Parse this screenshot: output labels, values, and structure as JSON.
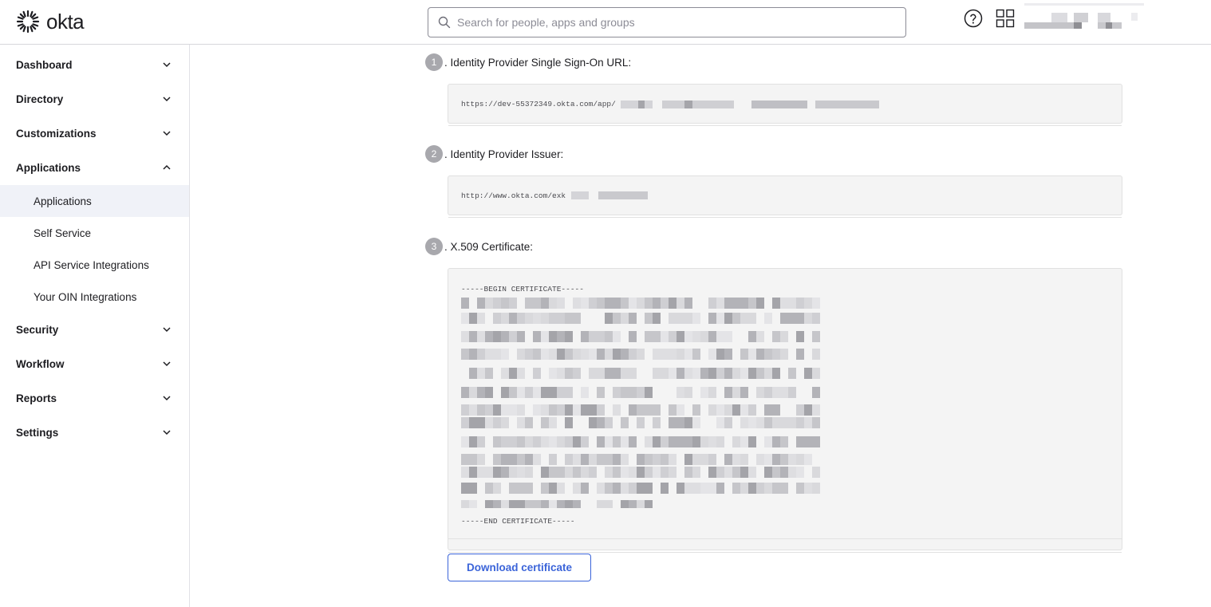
{
  "header": {
    "logo_text": "okta",
    "search": {
      "placeholder": "Search for people, apps and groups",
      "value": ""
    }
  },
  "sidebar": {
    "items": [
      {
        "label": "Dashboard",
        "expanded": false
      },
      {
        "label": "Directory",
        "expanded": false
      },
      {
        "label": "Customizations",
        "expanded": false
      },
      {
        "label": "Applications",
        "expanded": true,
        "children": [
          {
            "label": "Applications",
            "active": true
          },
          {
            "label": "Self Service",
            "active": false
          },
          {
            "label": "API Service Integrations",
            "active": false
          },
          {
            "label": "Your OIN Integrations",
            "active": false
          }
        ]
      },
      {
        "label": "Security",
        "expanded": false
      },
      {
        "label": "Workflow",
        "expanded": false
      },
      {
        "label": "Reports",
        "expanded": false
      },
      {
        "label": "Settings",
        "expanded": false
      }
    ]
  },
  "main": {
    "steps": [
      {
        "number": "1",
        "label": ". Identity Provider Single Sign-On URL:",
        "value": "https://dev-55372349.okta.com/app/"
      },
      {
        "number": "2",
        "label": ". Identity Provider Issuer:",
        "value": "http://www.okta.com/exk"
      },
      {
        "number": "3",
        "label": ". X.509 Certificate:",
        "begin": "-----BEGIN CERTIFICATE-----",
        "end": "-----END CERTIFICATE-----"
      }
    ],
    "download_label": "Download certificate"
  },
  "colors": {
    "accent": "#3b64d9",
    "step_badge": "#a8a8ad",
    "code_bg": "#f4f4f4"
  }
}
